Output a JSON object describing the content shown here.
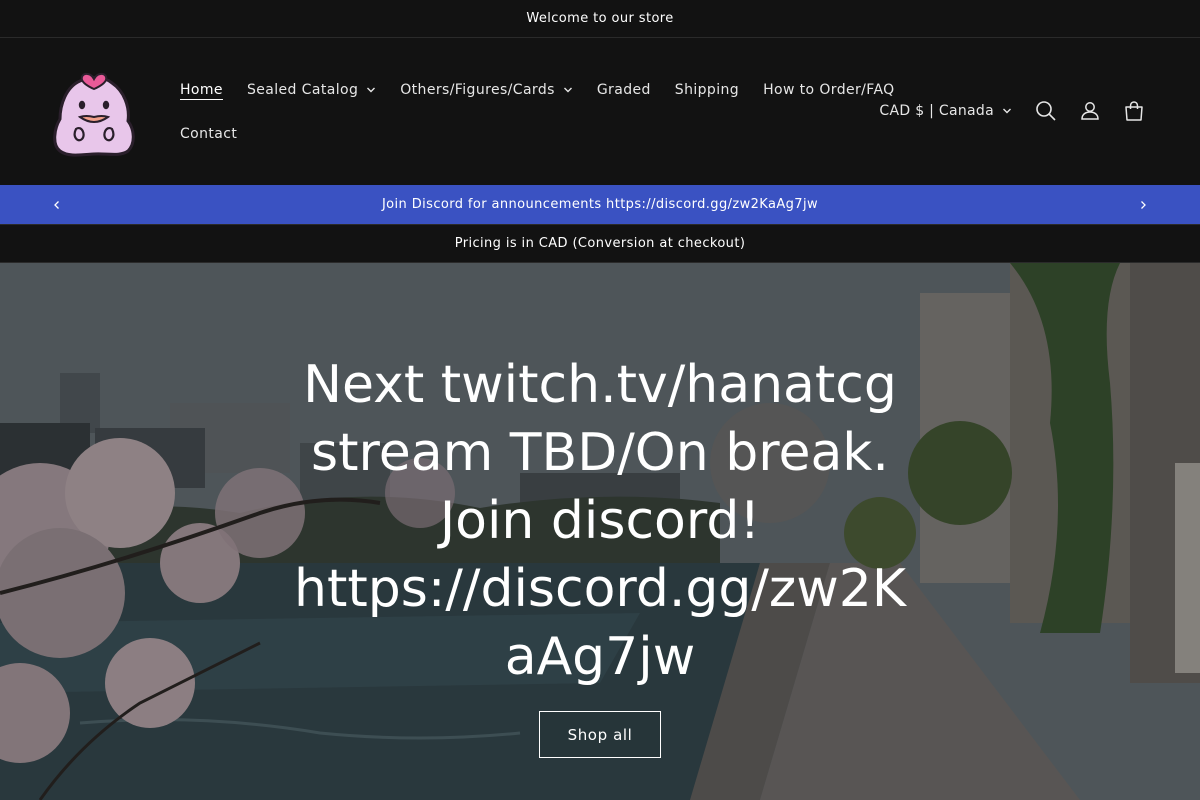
{
  "topbar": {
    "text": "Welcome to our store"
  },
  "header": {
    "logo_icon": "ghost-mascot-icon",
    "nav": [
      {
        "label": "Home",
        "active": true,
        "dropdown": false
      },
      {
        "label": "Sealed Catalog",
        "active": false,
        "dropdown": true
      },
      {
        "label": "Others/Figures/Cards",
        "active": false,
        "dropdown": true
      },
      {
        "label": "Graded",
        "active": false,
        "dropdown": false
      },
      {
        "label": "Shipping",
        "active": false,
        "dropdown": false
      },
      {
        "label": "How to Order/FAQ",
        "active": false,
        "dropdown": false
      },
      {
        "label": "Contact",
        "active": false,
        "dropdown": false
      }
    ],
    "locale": "CAD $ | Canada",
    "icons": [
      "search-icon",
      "account-icon",
      "cart-icon"
    ]
  },
  "announcement": {
    "text": "Join Discord for announcements https://discord.gg/zw2KaAg7jw",
    "prev_icon": "chevron-left-icon",
    "next_icon": "chevron-right-icon"
  },
  "pricing": {
    "text": "Pricing is in CAD (Conversion at checkout)"
  },
  "hero": {
    "title": "Next twitch.tv/hanatcg stream TBD/On break. Join discord! https://discord.gg/zw2KaAg7jw",
    "button_label": "Shop all"
  },
  "colors": {
    "background": "#121212",
    "announcement_bar": "#3a52c2",
    "text": "#ffffff"
  }
}
